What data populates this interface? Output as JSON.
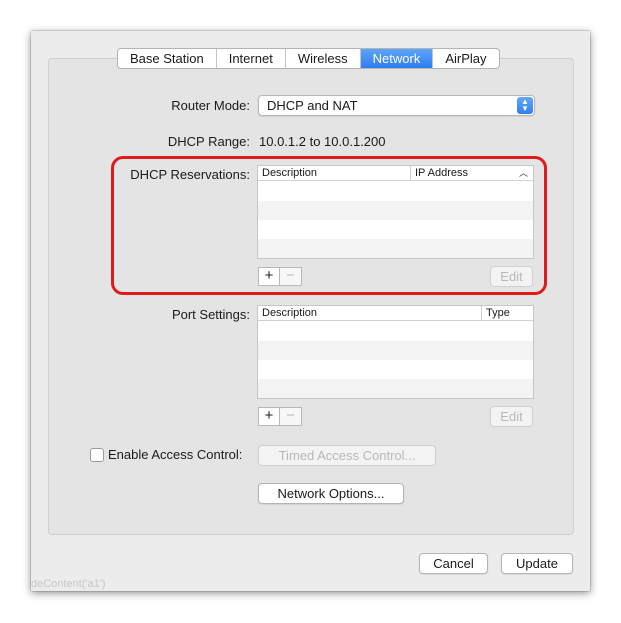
{
  "tabs": [
    {
      "label": "Base Station",
      "active": false
    },
    {
      "label": "Internet",
      "active": false
    },
    {
      "label": "Wireless",
      "active": false
    },
    {
      "label": "Network",
      "active": true
    },
    {
      "label": "AirPlay",
      "active": false
    }
  ],
  "router_mode": {
    "label": "Router Mode:",
    "value": "DHCP and NAT"
  },
  "dhcp_range": {
    "label": "DHCP Range:",
    "value": "10.0.1.2 to 10.0.1.200"
  },
  "dhcp_reservations": {
    "label": "DHCP Reservations:",
    "columns": [
      "Description",
      "IP Address"
    ],
    "add": "+",
    "remove": "−",
    "edit": "Edit"
  },
  "port_settings": {
    "label": "Port Settings:",
    "columns": [
      "Description",
      "Type"
    ],
    "add": "+",
    "remove": "−",
    "edit": "Edit"
  },
  "access_control": {
    "checkbox_label": "Enable Access Control:",
    "checked": false,
    "timed_button": "Timed Access Control..."
  },
  "network_options_button": "Network Options...",
  "footer": {
    "cancel": "Cancel",
    "update": "Update"
  },
  "ghost_text": "deContent('a1')",
  "highlight_color": "#e01a1a",
  "accent_color": "#2d7cf0"
}
